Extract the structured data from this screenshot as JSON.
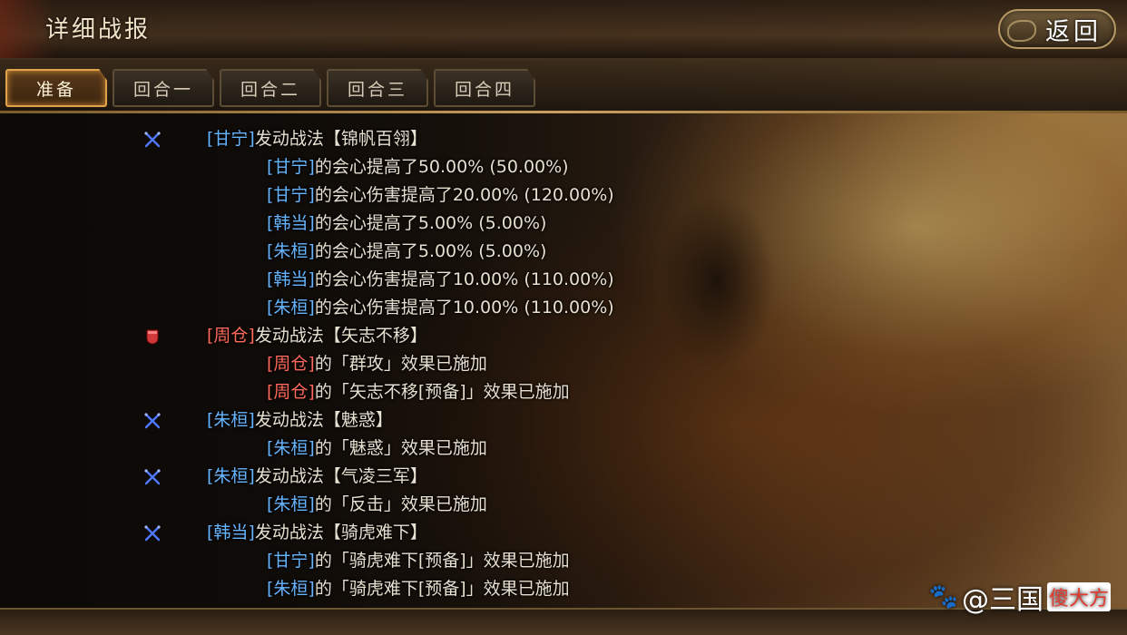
{
  "header": {
    "title": "详细战报",
    "back_label": "返回"
  },
  "tabs": [
    "准备",
    "回合一",
    "回合二",
    "回合三",
    "回合四"
  ],
  "active_tab": 0,
  "log": [
    {
      "type": "main",
      "icon": "sword-icon",
      "faction": "blue",
      "name": "[甘宁]",
      "text": "发动战法【锦帆百翎】"
    },
    {
      "type": "sub",
      "faction": "blue",
      "name": "[甘宁]",
      "text": "的会心提高了50.00% (50.00%)"
    },
    {
      "type": "sub",
      "faction": "blue",
      "name": "[甘宁]",
      "text": "的会心伤害提高了20.00% (120.00%)"
    },
    {
      "type": "sub",
      "faction": "blue",
      "name": "[韩当]",
      "text": "的会心提高了5.00% (5.00%)"
    },
    {
      "type": "sub",
      "faction": "blue",
      "name": "[朱桓]",
      "text": "的会心提高了5.00% (5.00%)"
    },
    {
      "type": "sub",
      "faction": "blue",
      "name": "[韩当]",
      "text": "的会心伤害提高了10.00% (110.00%)"
    },
    {
      "type": "sub",
      "faction": "blue",
      "name": "[朱桓]",
      "text": "的会心伤害提高了10.00% (110.00%)"
    },
    {
      "type": "main",
      "icon": "shield-icon",
      "faction": "red",
      "name": "[周仓]",
      "text": "发动战法【矢志不移】"
    },
    {
      "type": "sub",
      "faction": "red",
      "name": "[周仓]",
      "text": "的「群攻」效果已施加"
    },
    {
      "type": "sub",
      "faction": "red",
      "name": "[周仓]",
      "text": "的「矢志不移[预备]」效果已施加"
    },
    {
      "type": "main",
      "icon": "sword-icon",
      "faction": "blue",
      "name": "[朱桓]",
      "text": "发动战法【魅惑】"
    },
    {
      "type": "sub",
      "faction": "blue",
      "name": "[朱桓]",
      "text": "的「魅惑」效果已施加"
    },
    {
      "type": "main",
      "icon": "sword-icon",
      "faction": "blue",
      "name": "[朱桓]",
      "text": "发动战法【气凌三军】"
    },
    {
      "type": "sub",
      "faction": "blue",
      "name": "[朱桓]",
      "text": "的「反击」效果已施加"
    },
    {
      "type": "main",
      "icon": "sword-icon",
      "faction": "blue",
      "name": "[韩当]",
      "text": "发动战法【骑虎难下】"
    },
    {
      "type": "sub",
      "faction": "blue",
      "name": "[甘宁]",
      "text": "的「骑虎难下[预备]」效果已施加"
    },
    {
      "type": "sub",
      "faction": "blue",
      "name": "[朱桓]",
      "text": "的「骑虎难下[预备]」效果已施加"
    }
  ],
  "watermark": {
    "prefix": "@三国",
    "accent": "傻大方"
  },
  "colors": {
    "ally_name": "#67b4ff",
    "enemy_name": "#ff6a5a",
    "active_tab_border": "#e2a24a"
  }
}
